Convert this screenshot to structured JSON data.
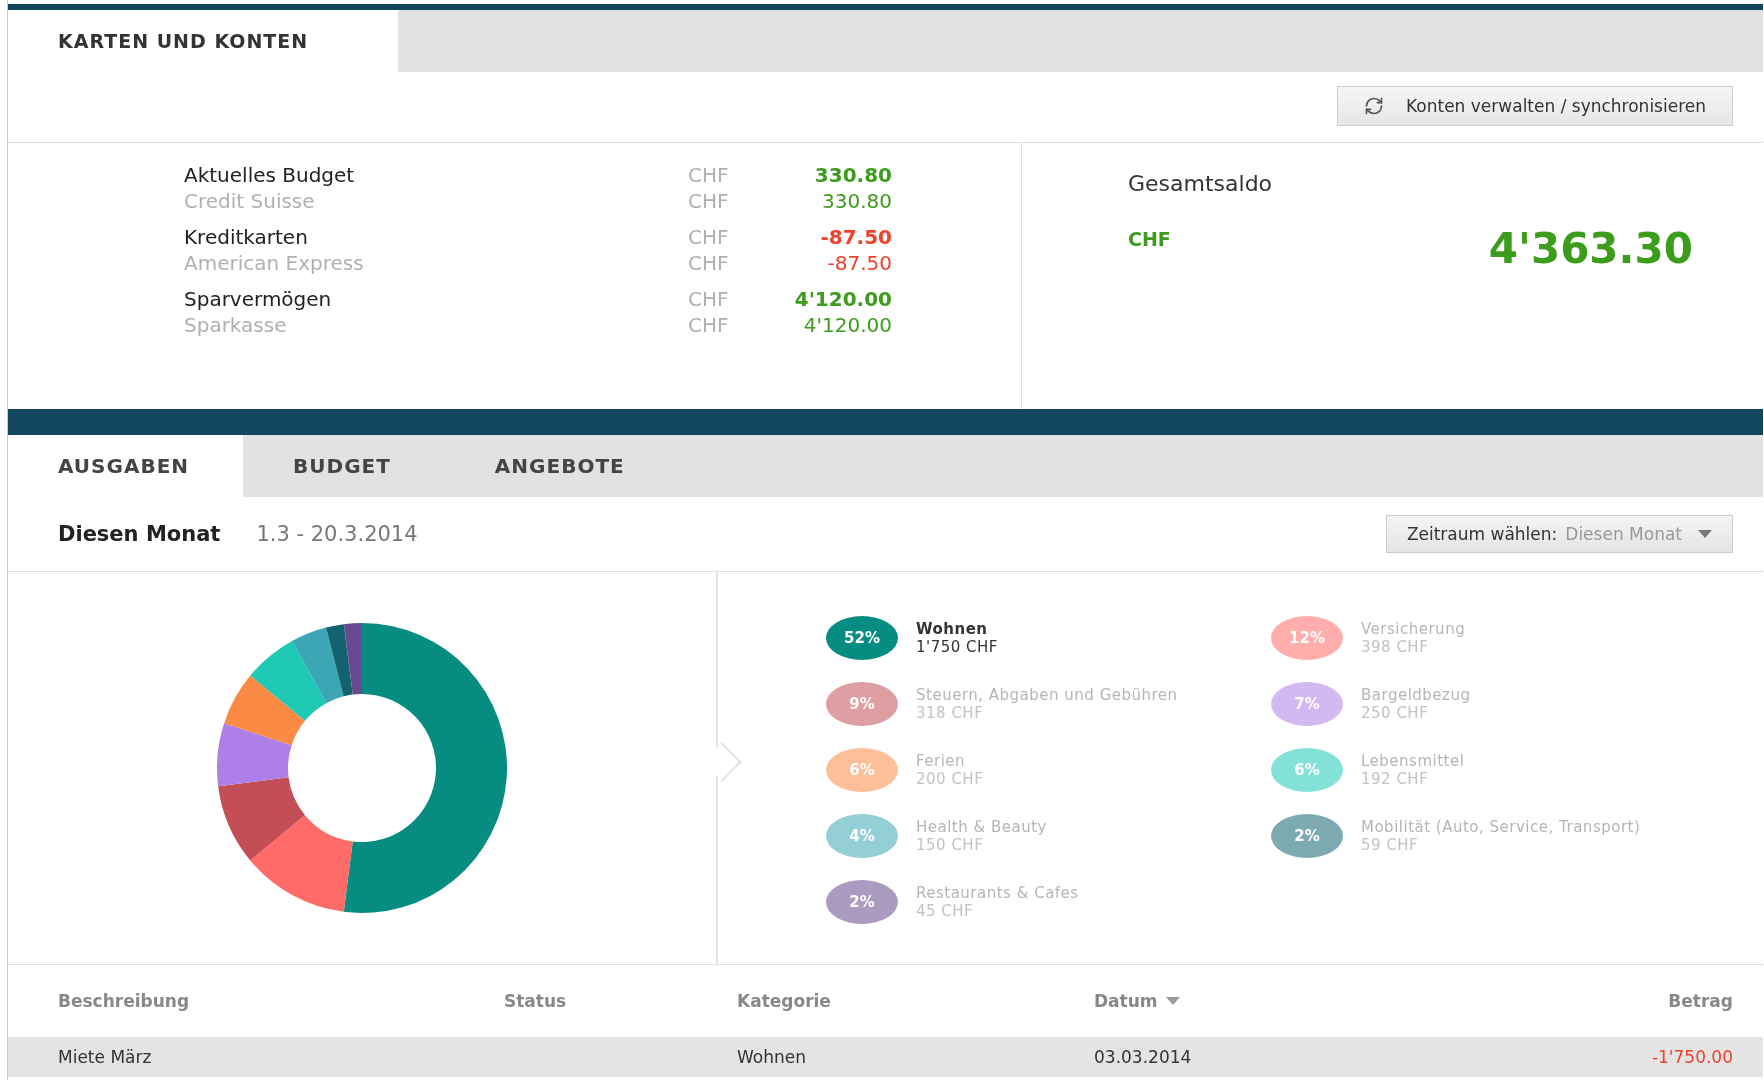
{
  "top_tabs": [
    {
      "label": "KARTEN UND KONTEN",
      "selected": true
    }
  ],
  "sync_button": {
    "label": "Konten verwalten / synchronisieren"
  },
  "accounts": [
    {
      "name": "Aktuelles Budget",
      "currency": "CHF",
      "amount": "330.80",
      "color": "#3c9c1c",
      "bank": {
        "name": "Credit Suisse",
        "currency": "CHF",
        "amount": "330.80"
      }
    },
    {
      "name": "Kreditkarten",
      "currency": "CHF",
      "amount": "-87.50",
      "color": "#f0412b",
      "bank": {
        "name": "American Express",
        "currency": "CHF",
        "amount": "-87.50"
      }
    },
    {
      "name": "Sparvermögen",
      "currency": "CHF",
      "amount": "4'120.00",
      "color": "#3c9c1c",
      "bank": {
        "name": "Sparkasse",
        "currency": "CHF",
        "amount": "4'120.00"
      }
    }
  ],
  "total": {
    "label": "Gesamtsaldo",
    "currency": "CHF",
    "amount": "4'363.30"
  },
  "section_tabs": [
    {
      "label": "AUSGABEN",
      "selected": true
    },
    {
      "label": "BUDGET",
      "selected": false
    },
    {
      "label": "ANGEBOTE",
      "selected": false
    }
  ],
  "period": {
    "title": "Diesen Monat",
    "range": "1.3 - 20.3.2014",
    "picker_label": "Zeitraum wählen:",
    "picker_value": "Diesen Monat"
  },
  "legend": [
    {
      "percent": "52%",
      "amount": "1'750 CHF",
      "color": "#078c82",
      "selected": true
    },
    {
      "percent": "12%",
      "amount": "398 CHF",
      "color": "#ff6b68",
      "selected": false
    },
    {
      "percent": "9%",
      "amount": "318 CHF",
      "color": "#c44e55",
      "selected": false
    },
    {
      "percent": "7%",
      "amount": "250 CHF",
      "color": "#ae7fe6",
      "selected": false
    },
    {
      "percent": "6%",
      "amount": "200 CHF",
      "color": "#fb8b44",
      "selected": false
    },
    {
      "percent": "6%",
      "amount": "192 CHF",
      "color": "#20c9b6",
      "selected": false
    },
    {
      "percent": "4%",
      "amount": "150 CHF",
      "color": "#3ca6b5",
      "selected": false
    },
    {
      "percent": "2%",
      "amount": "59 CHF",
      "color": "#12626f",
      "selected": false
    },
    {
      "percent": "2%",
      "amount": "45 CHF",
      "color": "#674a8f",
      "selected": false
    }
  ],
  "chart_data": {
    "type": "donut",
    "categories": [
      "Wohnen",
      "Versicherung",
      "Steuern, Abgaben und Gebühren",
      "Bargeldbezug",
      "Ferien",
      "Lebensmittel",
      "Health & Beauty",
      "Mobilität (Auto, Service, Transport)",
      "Restaurants & Cafes"
    ],
    "values": [
      52,
      12,
      9,
      7,
      6,
      6,
      4,
      2,
      2
    ]
  },
  "table": {
    "columns": [
      {
        "label": "Beschreibung",
        "sorted": false
      },
      {
        "label": "Status",
        "sorted": false
      },
      {
        "label": "Kategorie",
        "sorted": false
      },
      {
        "label": "Datum",
        "sorted": true
      },
      {
        "label": "Betrag",
        "sorted": false
      }
    ],
    "rows": [
      {
        "cells": [
          "Miete März",
          "",
          "Wohnen",
          "03.03.2014",
          "-1'750.00"
        ],
        "selected": true
      }
    ]
  }
}
